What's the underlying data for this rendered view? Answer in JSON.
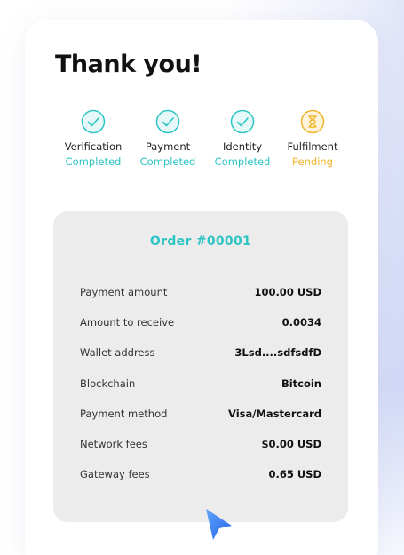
{
  "page": {
    "title": "Thank you!"
  },
  "steps": [
    {
      "name": "Verification",
      "status": "Completed",
      "state": "completed",
      "icon": "check-circle-icon"
    },
    {
      "name": "Payment",
      "status": "Completed",
      "state": "completed",
      "icon": "check-circle-icon"
    },
    {
      "name": "Identity",
      "status": "Completed",
      "state": "completed",
      "icon": "check-circle-icon"
    },
    {
      "name": "Fulfilment",
      "status": "Pending",
      "state": "pending",
      "icon": "hourglass-icon"
    }
  ],
  "order": {
    "title": "Order #00001",
    "rows": [
      {
        "label": "Payment amount",
        "value": "100.00 USD"
      },
      {
        "label": "Amount to receive",
        "value": "0.0034"
      },
      {
        "label": "Wallet address",
        "value": "3Lsd....sdfsdfD"
      },
      {
        "label": "Blockchain",
        "value": "Bitcoin"
      },
      {
        "label": "Payment method",
        "value": "Visa/Mastercard"
      },
      {
        "label": "Network fees",
        "value": "$0.00 USD"
      },
      {
        "label": "Gateway fees",
        "value": "0.65 USD"
      }
    ]
  },
  "colors": {
    "accent": "#2ec4c4",
    "pending": "#f0b429",
    "card_bg": "#ffffff",
    "panel_bg": "#ececec",
    "cursor": "#3b82f6"
  },
  "icons": {
    "cursor": "cursor-arrow-icon"
  }
}
